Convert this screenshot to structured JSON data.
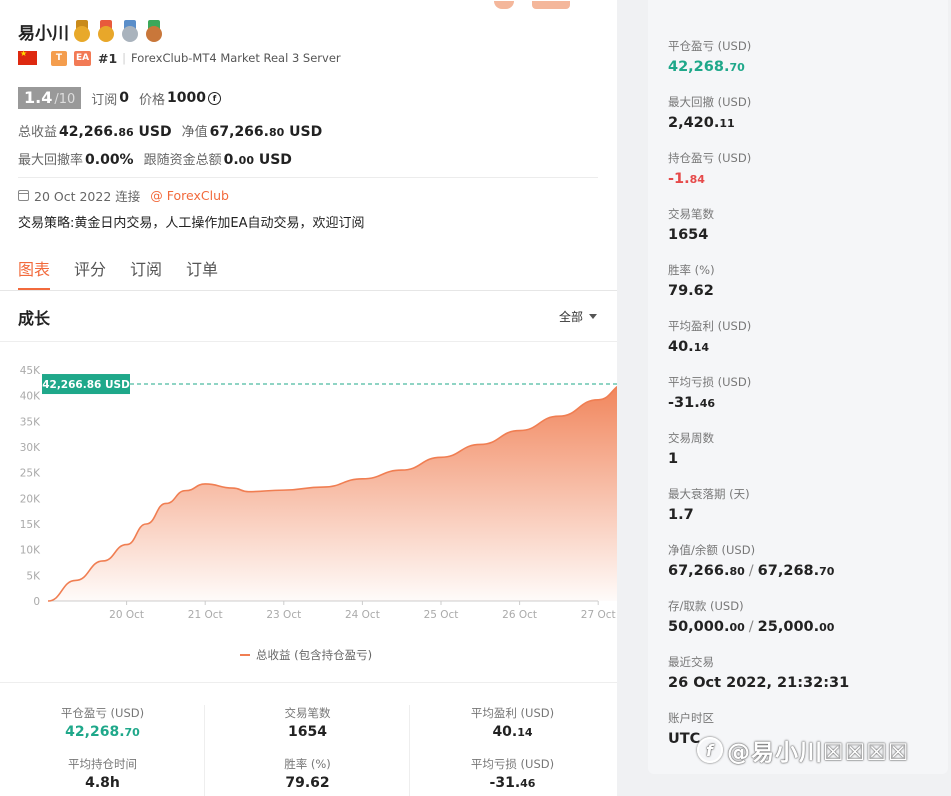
{
  "header": {
    "name": "易小川",
    "medals": [
      {
        "name": "trophy-icon",
        "rib": "#c98a1a",
        "disc": "#e8a92a"
      },
      {
        "name": "gold-medal-icon",
        "rib": "#e85a3c",
        "disc": "#e8a72a"
      },
      {
        "name": "silver-medal-icon",
        "rib": "#5a8ec9",
        "disc": "#a9b3bd"
      },
      {
        "name": "bronze-medal-icon",
        "rib": "#3ca85a",
        "disc": "#c9773a"
      }
    ],
    "tag_t": "T",
    "tag_ea": "EA",
    "rank": "#1",
    "server": "ForexClub-MT4 Market Real 3 Server"
  },
  "score": {
    "value": "1.4",
    "max": "/10",
    "sub_label": "订阅",
    "sub_value": "0",
    "price_label": "价格",
    "price_value": "1000"
  },
  "stats": {
    "total_profit_label": "总收益",
    "total_profit_int": "42,266.",
    "total_profit_dec": "86",
    "total_profit_unit": "USD",
    "equity_label": "净值",
    "equity_int": "67,266.",
    "equity_dec": "80",
    "equity_unit": "USD",
    "max_dd_label": "最大回撤率",
    "max_dd_value": "0.00%",
    "follow_label": "跟随资金总额",
    "follow_int": "0.",
    "follow_dec": "00",
    "follow_unit": "USD"
  },
  "connection": {
    "date": "20 Oct 2022 连接",
    "broker": "@ ForexClub"
  },
  "strategy": "交易策略:黄金日内交易，人工操作加EA自动交易，欢迎订阅",
  "tabs": [
    "图表",
    "评分",
    "订阅",
    "订单"
  ],
  "growth": {
    "title": "成长",
    "range": "全部"
  },
  "chart_data": {
    "type": "area",
    "series": [
      {
        "name": "总收益 (包含持仓盈亏)"
      }
    ],
    "x_ticks": [
      "20 Oct",
      "21 Oct",
      "23 Oct",
      "24 Oct",
      "25 Oct",
      "26 Oct",
      "27 Oct"
    ],
    "y_ticks": [
      "0",
      "5K",
      "10K",
      "15K",
      "20K",
      "25K",
      "30K",
      "35K",
      "40K",
      "45K"
    ],
    "ylim": [
      0,
      45000
    ],
    "points": [
      [
        0,
        0
      ],
      [
        0.35,
        4000
      ],
      [
        0.7,
        7800
      ],
      [
        1.0,
        11000
      ],
      [
        1.25,
        15000
      ],
      [
        1.5,
        19000
      ],
      [
        1.75,
        21500
      ],
      [
        2.0,
        22800
      ],
      [
        2.35,
        22000
      ],
      [
        2.55,
        21300
      ],
      [
        3.0,
        21600
      ],
      [
        3.5,
        22200
      ],
      [
        4.0,
        23800
      ],
      [
        4.5,
        25500
      ],
      [
        5.0,
        28000
      ],
      [
        5.5,
        30500
      ],
      [
        6.0,
        33200
      ],
      [
        6.5,
        36000
      ],
      [
        7.0,
        39200
      ],
      [
        7.35,
        42266.86
      ]
    ],
    "current_label": "42,266.86 USD",
    "current_value": 42266.86,
    "colors": {
      "line": "#f07e52",
      "label_bg": "#1fa88a"
    }
  },
  "bottom_stats": [
    {
      "label": "平仓盈亏 (USD)",
      "int": "42,268.",
      "dec": "70",
      "green": true
    },
    {
      "label": "交易笔数",
      "int": "1654",
      "dec": "",
      "green": false
    },
    {
      "label": "平均盈利 (USD)",
      "int": "40.",
      "dec": "14",
      "green": false
    },
    {
      "label": "平均持仓时间",
      "int": "4.8h",
      "dec": "",
      "green": false
    },
    {
      "label": "胜率 (%)",
      "int": "79.62",
      "dec": "",
      "green": false
    },
    {
      "label": "平均亏损 (USD)",
      "int": "-31.",
      "dec": "46",
      "green": false
    }
  ],
  "right_stats": [
    {
      "label": "平仓盈亏 (USD)",
      "int": "42,268.",
      "dec": "70",
      "color": "green"
    },
    {
      "label": "最大回撤 (USD)",
      "int": "2,420.",
      "dec": "11",
      "color": ""
    },
    {
      "label": "持仓盈亏 (USD)",
      "int": "-1.",
      "dec": "84",
      "color": "red"
    },
    {
      "label": "交易笔数",
      "int": "1654",
      "dec": "",
      "color": ""
    },
    {
      "label": "胜率 (%)",
      "int": "79.62",
      "dec": "",
      "color": ""
    },
    {
      "label": "平均盈利 (USD)",
      "int": "40.",
      "dec": "14",
      "color": ""
    },
    {
      "label": "平均亏损 (USD)",
      "int": "-31.",
      "dec": "46",
      "color": ""
    },
    {
      "label": "交易周数",
      "int": "1",
      "dec": "",
      "color": ""
    },
    {
      "label": "最大衰落期 (天)",
      "int": "1.7",
      "dec": "",
      "color": ""
    }
  ],
  "balance": {
    "label": "净值/余额 (USD)",
    "a_int": "67,266.",
    "a_dec": "80",
    "sep": "/",
    "b_int": "67,268.",
    "b_dec": "70"
  },
  "deposit": {
    "label": "存/取款 (USD)",
    "a_int": "50,000.",
    "a_dec": "00",
    "sep": "/",
    "b_int": "25,000.",
    "b_dec": "00"
  },
  "last_trade": {
    "label": "最近交易",
    "value": "26 Oct 2022, 21:32:31"
  },
  "timezone": {
    "label": "账户时区",
    "value": "UTC"
  },
  "watermark": {
    "logo": "f",
    "text": "@易小川☒☒☒☒"
  }
}
